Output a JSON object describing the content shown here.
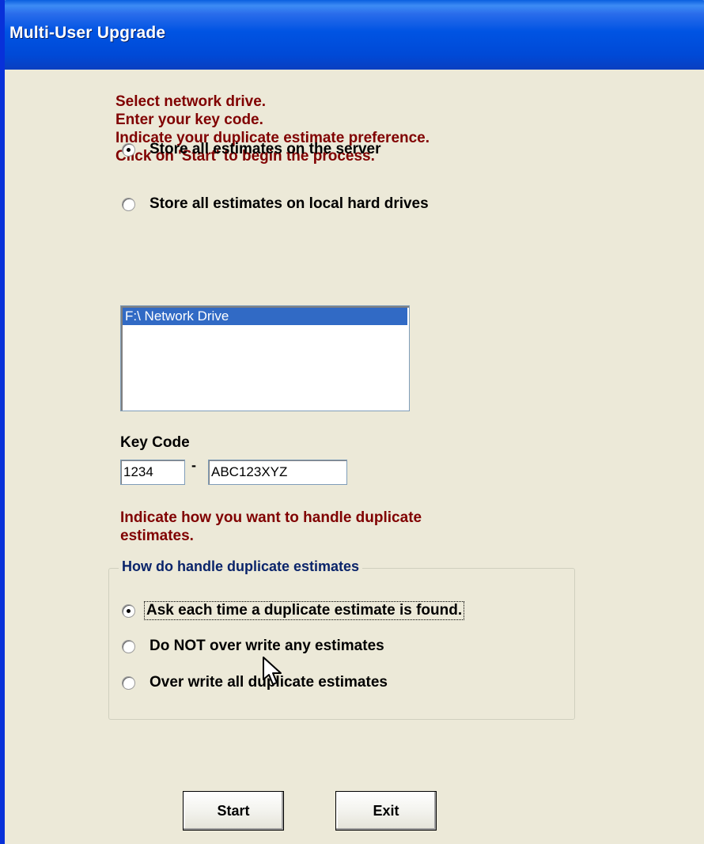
{
  "window": {
    "title": "Multi-User Upgrade"
  },
  "instructions": [
    "Select network drive.",
    "Enter your key code.",
    "Indicate your duplicate estimate preference.",
    "Click on 'Start' to begin the process."
  ],
  "storage_options": [
    {
      "label": "Store all estimates on the server",
      "selected": true
    },
    {
      "label": "Store all estimates on local hard drives",
      "selected": false
    }
  ],
  "drive_list": {
    "items": [
      "F:\\ Network Drive"
    ],
    "selected_index": 0
  },
  "key_code": {
    "label": "Key Code",
    "separator": "-",
    "part1": "1234",
    "part2": "ABC123XYZ"
  },
  "duplicate_instructions": [
    "Indicate how you want to handle duplicate",
    "estimates."
  ],
  "duplicate_group": {
    "title": "How do handle duplicate estimates",
    "options": [
      {
        "label": "Ask each time a duplicate estimate is found.",
        "selected": true
      },
      {
        "label": "Do NOT over write any estimates",
        "selected": false
      },
      {
        "label": "Over write all duplicate estimates",
        "selected": false
      }
    ]
  },
  "buttons": {
    "start": "Start",
    "exit": "Exit"
  },
  "colors": {
    "title_bar": "#0054E3",
    "window_background": "#ECE9D8",
    "instruction_text": "#800000",
    "group_title_text": "#0A246A",
    "selection_highlight": "#316AC5"
  },
  "icons": {
    "cursor": "mouse-pointer-icon"
  }
}
